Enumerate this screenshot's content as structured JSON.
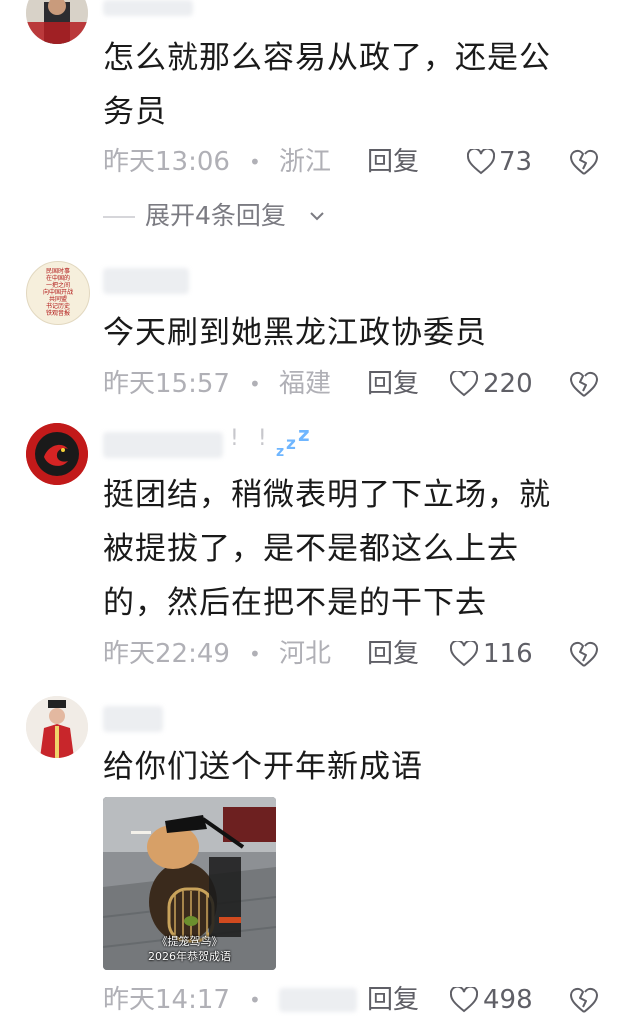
{
  "comments": [
    {
      "content_lines": [
        "怎么就那么容易从政了，还是公",
        "务员"
      ],
      "time": "昨天13:06",
      "location": "浙江",
      "reply_label": "回复",
      "likes": "73"
    },
    {
      "content_lines": [
        "今天刷到她黑龙江政协委员"
      ],
      "time": "昨天15:57",
      "location": "福建",
      "reply_label": "回复",
      "likes": "220"
    },
    {
      "username_suffix": "! !",
      "content_lines": [
        "挺团结，稍微表明了下立场，就",
        "被提拔了，是不是都这么上去",
        "的，然后在把不是的干下去"
      ],
      "time": "昨天22:49",
      "location": "河北",
      "reply_label": "回复",
      "likes": "116"
    },
    {
      "content_lines": [
        "给你们送个开年新成语"
      ],
      "image_caption_lines": [
        "《提笼驾鸟》",
        "2026年恭贺成语"
      ],
      "time": "昨天14:17",
      "reply_label": "回复",
      "likes": "498"
    }
  ],
  "expand_replies": "展开4条回复",
  "avatar2_text": [
    "民国时事",
    "在中国的",
    "一把之间",
    "向中国开战",
    "共同盟",
    "书记历史",
    "铁观音报"
  ],
  "colors": {
    "meta_gray": "#b0b0b6",
    "reply_gray": "#5f5f66",
    "zzz_blue": "#6fb6ff",
    "avatar3_red": "#c21a1a"
  },
  "icons": {
    "like": "heart-outline-icon",
    "dislike": "broken-heart-icon",
    "expand": "chevron-down-icon",
    "sleep": "zzz-icon"
  }
}
